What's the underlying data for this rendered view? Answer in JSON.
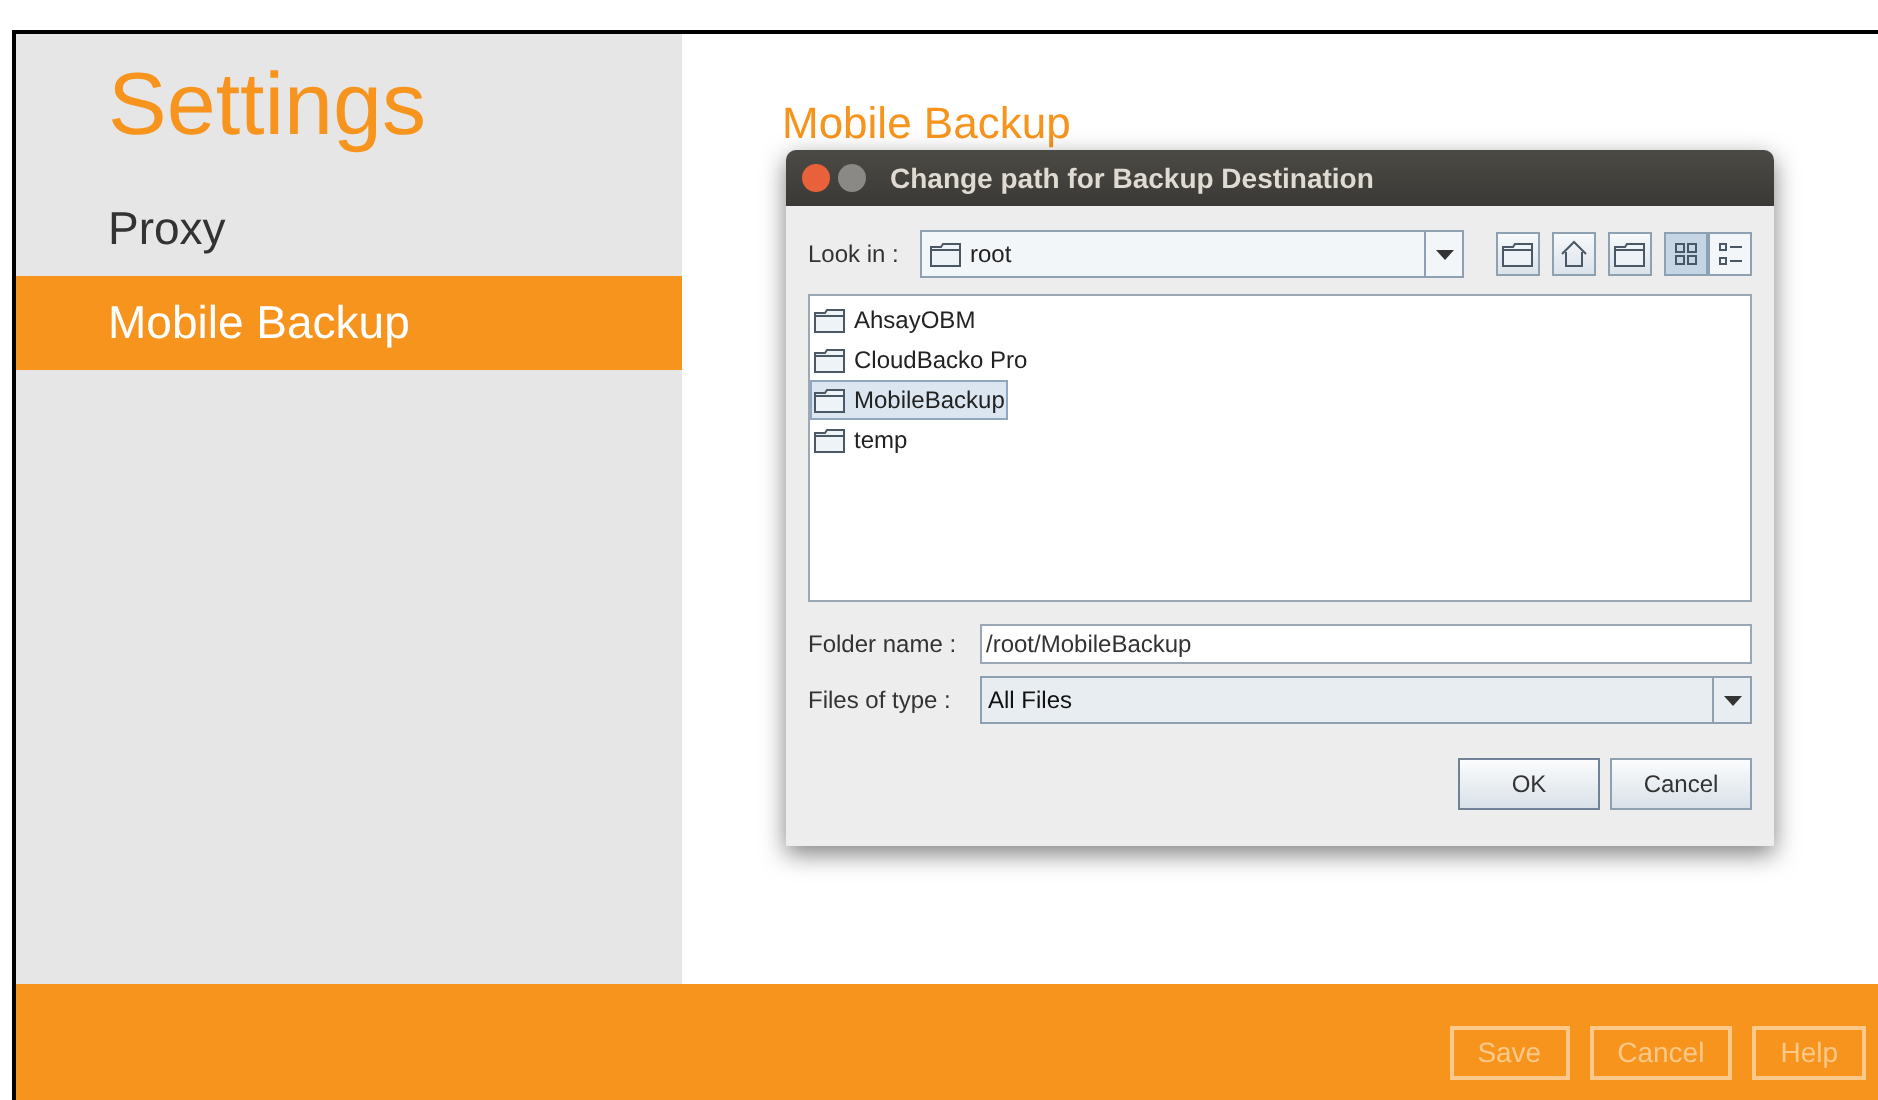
{
  "sidebar": {
    "title": "Settings",
    "items": [
      {
        "label": "Proxy",
        "selected": false
      },
      {
        "label": "Mobile Backup",
        "selected": true
      }
    ]
  },
  "content": {
    "title": "Mobile Backup"
  },
  "dialog": {
    "title": "Change path for Backup Destination",
    "look_in": {
      "label": "Look in :",
      "value": "root"
    },
    "view_buttons": [
      {
        "kind": "list",
        "selected": true
      },
      {
        "kind": "details",
        "selected": false
      }
    ],
    "files": [
      {
        "name": "AhsayOBM",
        "selected": false
      },
      {
        "name": "CloudBacko Pro",
        "selected": false
      },
      {
        "name": "MobileBackup",
        "selected": true
      },
      {
        "name": "temp",
        "selected": false
      }
    ],
    "folder_name": {
      "label": "Folder name :",
      "value": "/root/MobileBackup"
    },
    "files_of_type": {
      "label": "Files of type :",
      "value": "All Files"
    },
    "buttons": [
      "OK",
      "Cancel"
    ]
  },
  "footer": {
    "buttons": [
      {
        "label": "Save",
        "disabled": true
      },
      {
        "label": "Cancel",
        "disabled": true
      },
      {
        "label": "Help",
        "disabled": true
      }
    ]
  }
}
